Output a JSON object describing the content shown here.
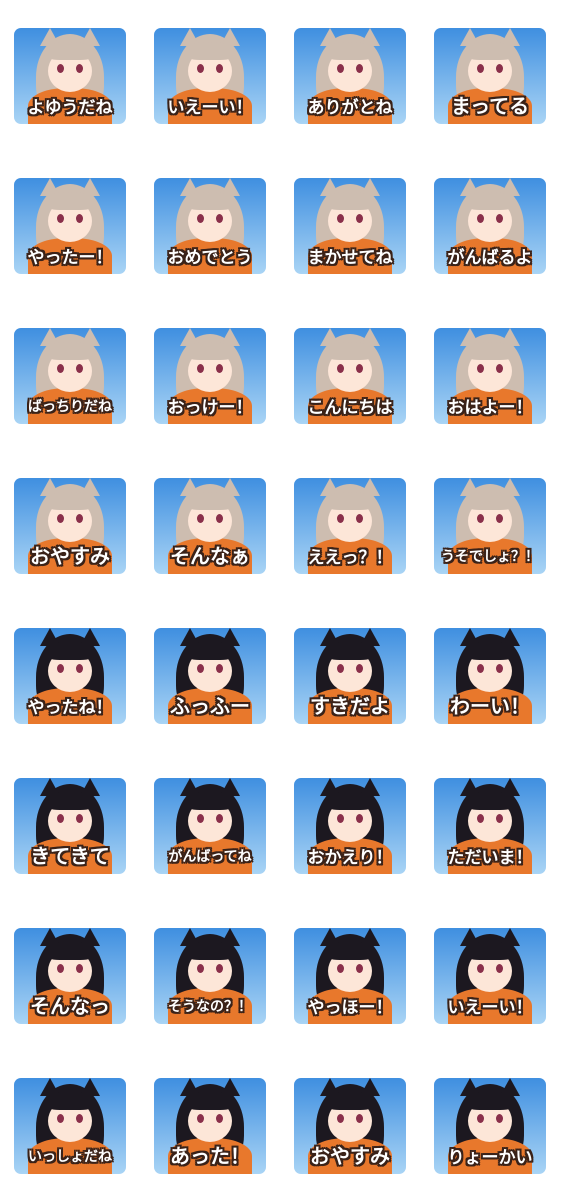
{
  "stickers": [
    {
      "caption": "よゆうだね",
      "hair": "light"
    },
    {
      "caption": "いえーい！",
      "hair": "light"
    },
    {
      "caption": "ありがとね",
      "hair": "light"
    },
    {
      "caption": "まってる",
      "hair": "light"
    },
    {
      "caption": "やったー！",
      "hair": "light"
    },
    {
      "caption": "おめでとう",
      "hair": "light"
    },
    {
      "caption": "まかせてね",
      "hair": "light"
    },
    {
      "caption": "がんばるよ",
      "hair": "light"
    },
    {
      "caption": "ばっちりだね",
      "hair": "light"
    },
    {
      "caption": "おっけー！",
      "hair": "light"
    },
    {
      "caption": "こんにちは",
      "hair": "light"
    },
    {
      "caption": "おはよー！",
      "hair": "light"
    },
    {
      "caption": "おやすみ",
      "hair": "light"
    },
    {
      "caption": "そんなぁ",
      "hair": "light"
    },
    {
      "caption": "ええっ？！",
      "hair": "light"
    },
    {
      "caption": "うそでしょ？！",
      "hair": "light"
    },
    {
      "caption": "やったね！",
      "hair": "dark"
    },
    {
      "caption": "ふっふー",
      "hair": "dark"
    },
    {
      "caption": "すきだよ",
      "hair": "dark"
    },
    {
      "caption": "わーい！",
      "hair": "dark"
    },
    {
      "caption": "きてきて",
      "hair": "dark"
    },
    {
      "caption": "がんばってね",
      "hair": "dark"
    },
    {
      "caption": "おかえり！",
      "hair": "dark"
    },
    {
      "caption": "ただいま！",
      "hair": "dark"
    },
    {
      "caption": "そんなっ",
      "hair": "dark"
    },
    {
      "caption": "そうなの？！",
      "hair": "dark"
    },
    {
      "caption": "やっほー！",
      "hair": "dark"
    },
    {
      "caption": "いえーい！",
      "hair": "dark"
    },
    {
      "caption": "いっしょだね",
      "hair": "dark"
    },
    {
      "caption": "あった！",
      "hair": "dark"
    },
    {
      "caption": "おやすみ",
      "hair": "dark"
    },
    {
      "caption": "りょーかい",
      "hair": "dark"
    }
  ],
  "colors": {
    "sky_top": "#3f8fe0",
    "sky_bottom": "#a9d4f5",
    "hoodie": "#e8782c",
    "hair_light": "#cdbdb0",
    "hair_dark": "#1c1820",
    "caption_outline": "#3a2218",
    "caption_fill": "#ffffff"
  }
}
